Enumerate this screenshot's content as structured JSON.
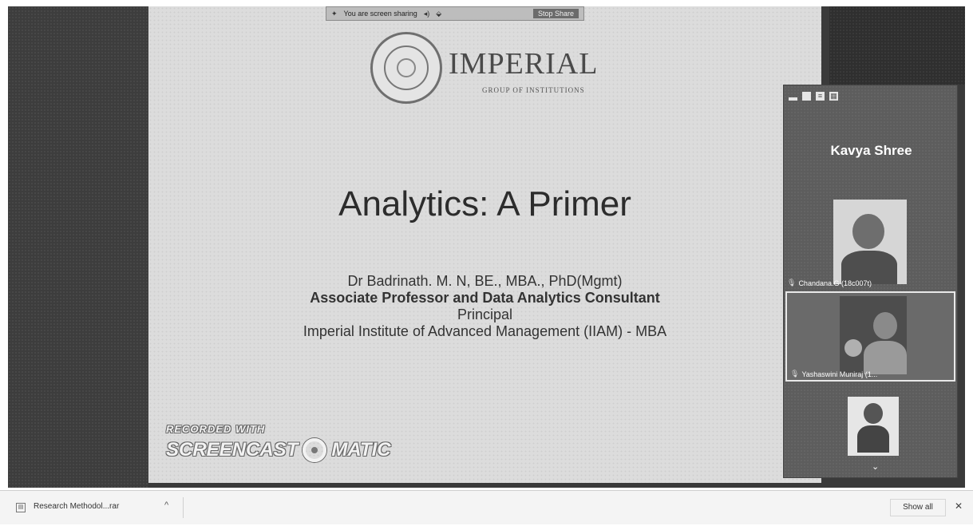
{
  "share_bar": {
    "status": "You are screen sharing",
    "stop_label": "Stop Share"
  },
  "slide": {
    "logo_name": "IMPERIAL",
    "logo_sub": "GROUP OF INSTITUTIONS",
    "title": "Analytics: A Primer",
    "author_line": "Dr Badrinath. M. N, BE., MBA., PhD(Mgmt)",
    "role_line": "Associate Professor and Data Analytics Consultant",
    "position_line": "Principal",
    "institute_line": "Imperial Institute of Advanced Management (IIAM) - MBA"
  },
  "watermark": {
    "top": "RECORDED WITH",
    "left": "SCREENCAST",
    "right": "MATIC"
  },
  "participants": {
    "active_speaker": "Kavya Shree",
    "tiles": [
      {
        "label": "Chandana.G (18c007t)"
      },
      {
        "label": "Yashaswini Muniraj (1..."
      },
      {
        "label": ""
      }
    ]
  },
  "downloads": {
    "file_name": "Research Methodol...rar",
    "show_all": "Show all"
  }
}
